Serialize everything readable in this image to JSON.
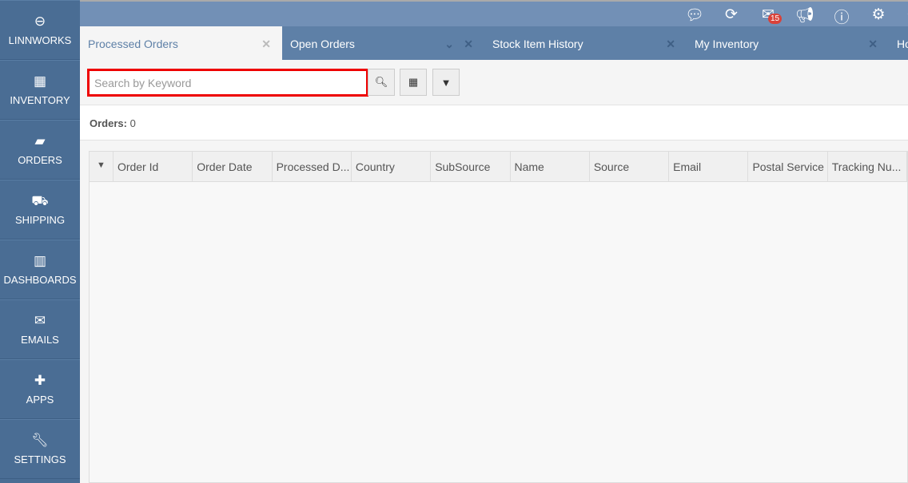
{
  "sidebar": {
    "items": [
      {
        "label": "LINNWORKS",
        "icon": "linnworks-logo-icon"
      },
      {
        "label": "INVENTORY",
        "icon": "cubes-icon"
      },
      {
        "label": "ORDERS",
        "icon": "book-icon"
      },
      {
        "label": "SHIPPING",
        "icon": "truck-icon"
      },
      {
        "label": "DASHBOARDS",
        "icon": "bar-chart-icon"
      },
      {
        "label": "EMAILS",
        "icon": "envelope-icon"
      },
      {
        "label": "APPS",
        "icon": "puzzle-icon"
      },
      {
        "label": "SETTINGS",
        "icon": "wrench-icon"
      }
    ]
  },
  "topbar": {
    "mail_badge": "15"
  },
  "tabs": [
    {
      "label": "Processed Orders"
    },
    {
      "label": "Open Orders"
    },
    {
      "label": "Stock Item History"
    },
    {
      "label": "My Inventory"
    },
    {
      "label": "Ho"
    }
  ],
  "search": {
    "placeholder": "Search by Keyword"
  },
  "orders": {
    "label": "Orders:",
    "count": "0"
  },
  "grid": {
    "columns": [
      "Order Id",
      "Order Date",
      "Processed D...",
      "Country",
      "SubSource",
      "Name",
      "Source",
      "Email",
      "Postal Service",
      "Tracking Nu..."
    ]
  }
}
